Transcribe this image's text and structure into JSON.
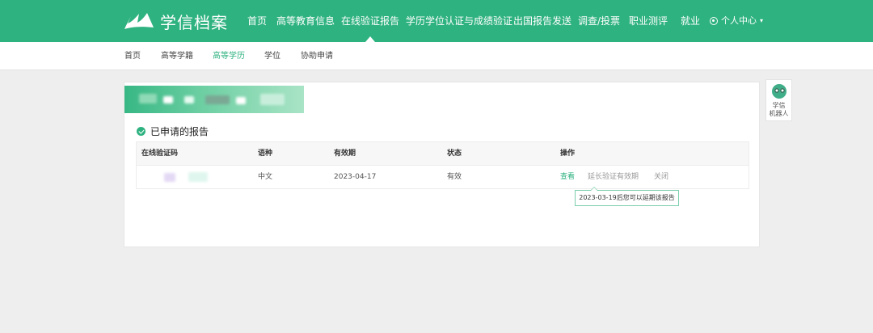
{
  "brand": {
    "name": "学信档案",
    "color": "#2eb280"
  },
  "nav": {
    "items": [
      "首页",
      "高等教育信息",
      "在线验证报告",
      "学历学位认证与成绩验证",
      "出国报告发送",
      "调查/投票",
      "职业测评",
      "就业"
    ],
    "active": "在线验证报告",
    "user_center": "个人中心"
  },
  "subnav": {
    "items": [
      "首页",
      "高等学籍",
      "高等学历",
      "学位",
      "协助申请"
    ],
    "active": "高等学历"
  },
  "section": {
    "title": "已申请的报告"
  },
  "table": {
    "headers": [
      "在线验证码",
      "语种",
      "有效期",
      "状态",
      "操作"
    ],
    "rows": [
      {
        "code": "",
        "language": "中文",
        "expiry": "2023-04-17",
        "status": "有效",
        "actions": [
          "查看",
          "延长验证有效期",
          "关闭"
        ]
      }
    ]
  },
  "tooltip": "2023-03-19后您可以延期该报告",
  "side_widget": {
    "label_line1": "学信",
    "label_line2": "机器人"
  }
}
